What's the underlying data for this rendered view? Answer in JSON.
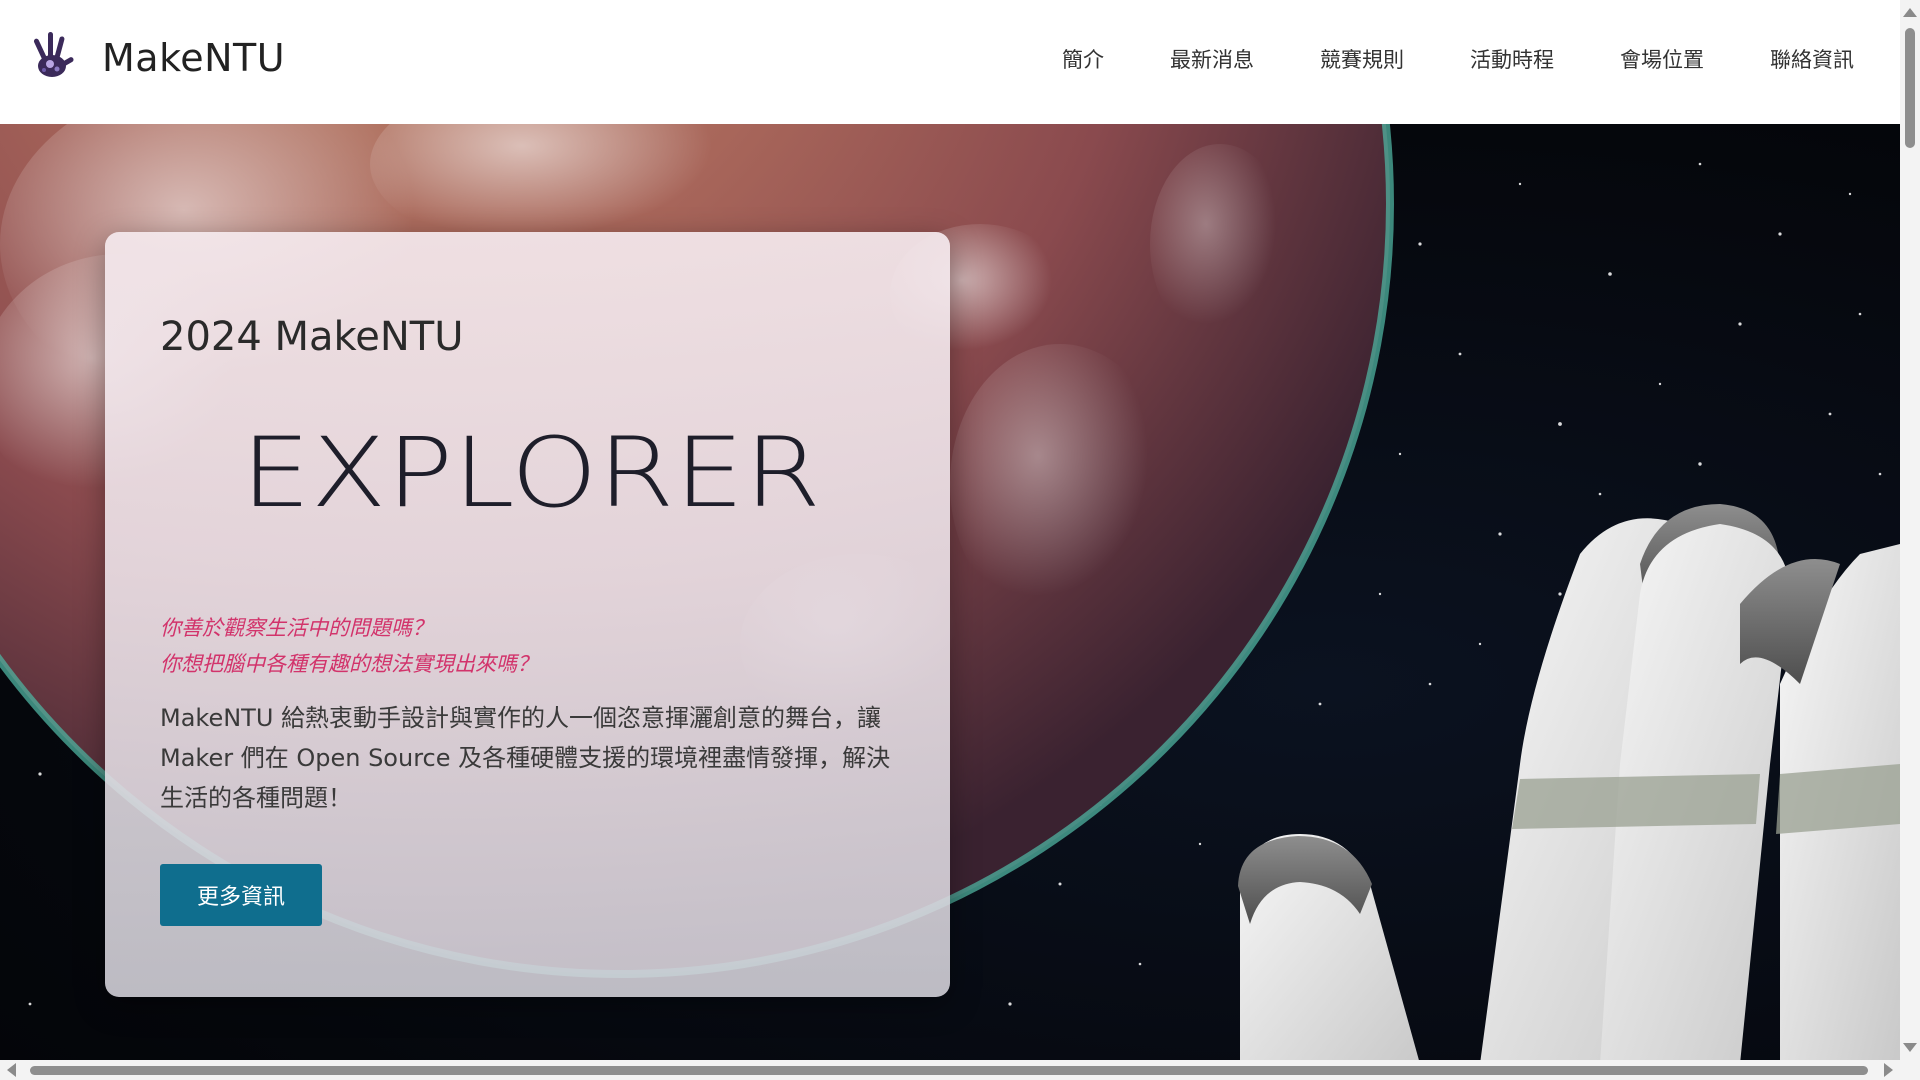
{
  "header": {
    "brand": "MakeNTU",
    "logo_icon": "hand-logo-icon",
    "nav": [
      {
        "label": "簡介"
      },
      {
        "label": "最新消息"
      },
      {
        "label": "競賽規則"
      },
      {
        "label": "活動時程"
      },
      {
        "label": "會場位置"
      },
      {
        "label": "聯絡資訊"
      }
    ]
  },
  "hero": {
    "card": {
      "title": "2024 MakeNTU",
      "logo_text": "EXPLORER",
      "tagline_1": "你善於觀察生活中的問題嗎？",
      "tagline_2": "你想把腦中各種有趣的想法實現出來嗎？",
      "description": "MakeNTU 給熱衷動手設計與實作的人一個恣意揮灑創意的舞台，讓 Maker 們在 Open Source 及各種硬體支援的環境裡盡情發揮，解決生活的各種問題！",
      "button_label": "更多資訊"
    }
  },
  "colors": {
    "accent_button": "#0f6e8e",
    "tagline": "#d2336b",
    "space": "#05070c"
  }
}
